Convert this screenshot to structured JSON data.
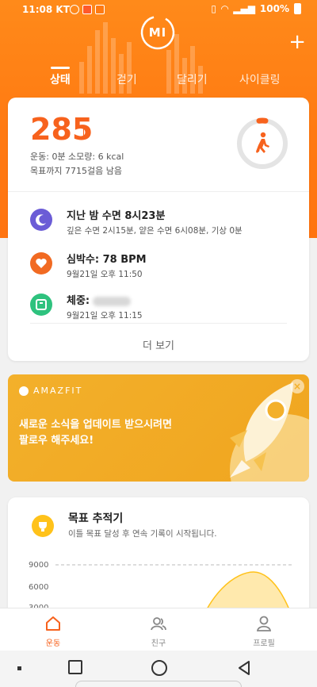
{
  "status_bar": {
    "time": "11:08",
    "carrier": "KT",
    "battery": "100%"
  },
  "header": {
    "logo_text": "MI",
    "tabs": [
      {
        "label": "상태",
        "active": true
      },
      {
        "label": "걷기",
        "active": false
      },
      {
        "label": "달리기",
        "active": false
      },
      {
        "label": "사이클링",
        "active": false
      }
    ]
  },
  "summary": {
    "steps": "285",
    "activity_line": "운동: 0분 소모량: 6 kcal",
    "goal_line": "목표까지 7715걸음 남음",
    "goal_progress": 0.036
  },
  "rows": {
    "sleep": {
      "title": "지난 밤 수면 8시23분",
      "sub": "깊은 수면 2시15분, 얕은 수면 6시08분, 기상 0분"
    },
    "heart": {
      "title": "심박수: 78 BPM",
      "sub": "9월21일 오후 11:50"
    },
    "weight": {
      "title": "체중:",
      "sub": "9월21일 오후 11:15"
    }
  },
  "more_label": "더 보기",
  "banner": {
    "brand": "AMAZFIT",
    "line1": "새로운 소식을 업데이트 받으시려면",
    "line2": "팔로우 해주세요!"
  },
  "goal_tracker": {
    "title": "목표 추적기",
    "subtitle": "이틀 목표 달성 후 연속 기록이 시작됩니다.",
    "ticks": [
      "9000",
      "6000",
      "3000"
    ]
  },
  "bottom_nav": [
    {
      "label": "운동",
      "active": true
    },
    {
      "label": "친구",
      "active": false
    },
    {
      "label": "프로필",
      "active": false
    }
  ],
  "colors": {
    "accent": "#f7621d",
    "header": "#ff8a1a",
    "banner": "#f3b02b",
    "sleep": "#6b5cd6",
    "heart": "#f16a22",
    "weight": "#2ec27e"
  }
}
